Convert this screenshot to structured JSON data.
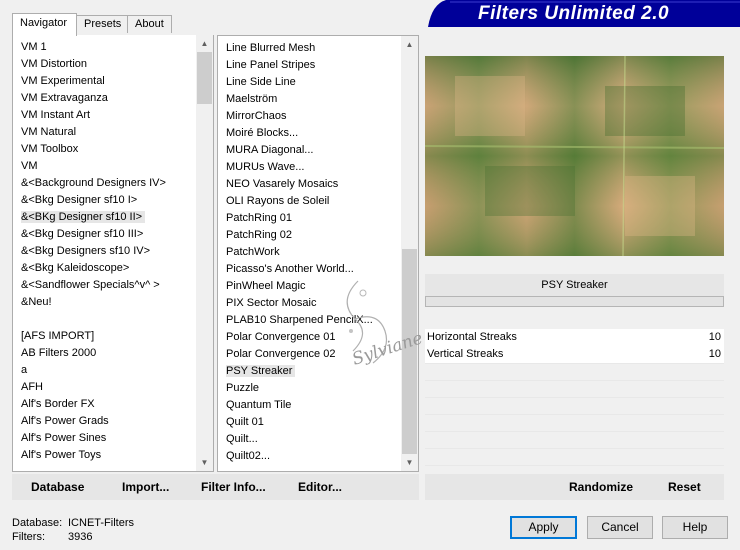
{
  "tabs": [
    "Navigator",
    "Presets",
    "About"
  ],
  "banner_title": "Filters Unlimited 2.0",
  "categories": [
    "VM 1",
    "VM Distortion",
    "VM Experimental",
    "VM Extravaganza",
    "VM Instant Art",
    "VM Natural",
    "VM Toolbox",
    "VM",
    "&<Background Designers IV>",
    "&<Bkg Designer sf10 I>",
    "&<BKg Designer sf10 II>",
    "&<Bkg Designer sf10 III>",
    "&<Bkg Designers sf10 IV>",
    "&<Bkg Kaleidoscope>",
    "&<Sandflower Specials^v^ >",
    "&Neu!",
    "",
    "[AFS IMPORT]",
    "AB Filters 2000",
    "a",
    "AFH",
    "Alf's Border FX",
    "Alf's Power Grads",
    "Alf's Power Sines",
    "Alf's Power Toys"
  ],
  "filters": [
    "Line Blurred Mesh",
    "Line Panel Stripes",
    "Line Side Line",
    "Maelström",
    "MirrorChaos",
    "Moiré Blocks...",
    "MURA Diagonal...",
    "MURUs Wave...",
    "NEO Vasarely Mosaics",
    "OLI Rayons de Soleil",
    "PatchRing 01",
    "PatchRing 02",
    "PatchWork",
    "Picasso's Another World...",
    "PinWheel Magic",
    "PIX Sector Mosaic",
    "PLAB10 Sharpened PencilX...",
    "Polar Convergence 01",
    "Polar Convergence 02",
    "PSY Streaker",
    "Puzzle",
    "Quantum Tile",
    "Quilt 01",
    "Quilt...",
    "Quilt02..."
  ],
  "selected_category": "&<BKg Designer sf10 II>",
  "selected_filter": "PSY Streaker",
  "preview_filter_name": "PSY Streaker",
  "parameters": [
    {
      "name": "Horizontal Streaks",
      "value": "10"
    },
    {
      "name": "Vertical Streaks",
      "value": "10"
    }
  ],
  "left_buttons": {
    "database": "Database",
    "import": "Import...",
    "filter_info": "Filter Info...",
    "editor": "Editor..."
  },
  "right_buttons": {
    "randomize": "Randomize",
    "reset": "Reset"
  },
  "status": {
    "database_label": "Database:",
    "database_value": "ICNET-Filters",
    "filters_label": "Filters:",
    "filters_value": "3936"
  },
  "dialog_buttons": {
    "apply": "Apply",
    "cancel": "Cancel",
    "help": "Help"
  },
  "watermark": "Sylviane",
  "colors": {
    "banner": "#000099",
    "accent": "#0078d7",
    "selection": "#e6e6e6"
  }
}
